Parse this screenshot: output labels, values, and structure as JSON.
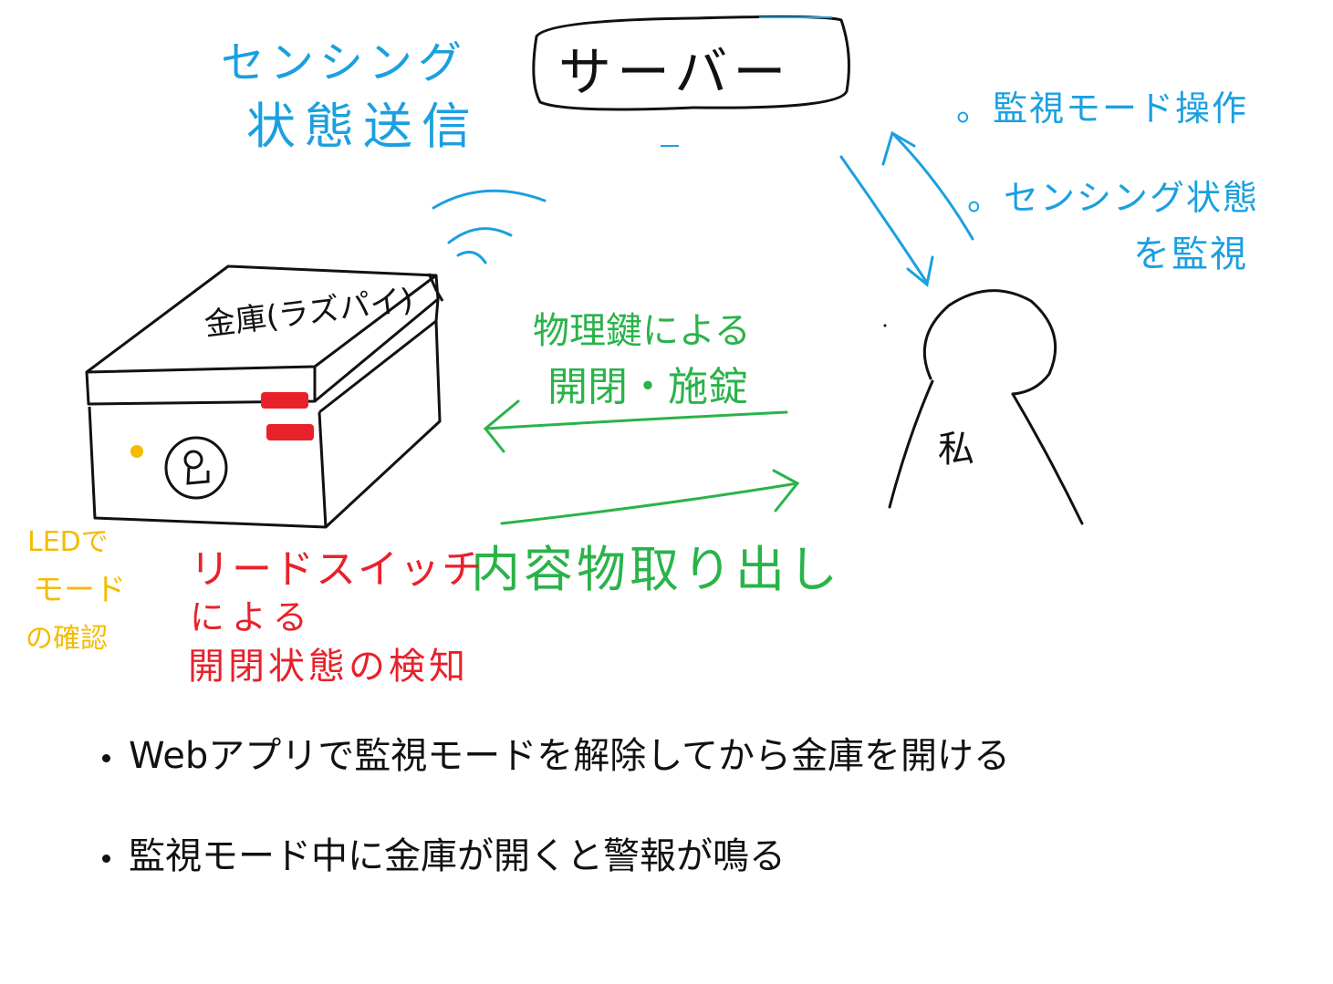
{
  "server": {
    "label": "サーバー"
  },
  "sensing_send": {
    "line1": "センシング",
    "line2": "状態送信"
  },
  "monitor_ops": {
    "item1": "。監視モード操作",
    "item2_line1": "。センシング状態",
    "item2_line2": "を監視"
  },
  "safe": {
    "label": "金庫(ラズパイ)"
  },
  "person": {
    "label": "私"
  },
  "physical_key": {
    "line1": "物理鍵による",
    "line2": "開閉・施錠"
  },
  "take_out": {
    "label": "内容物取り出し"
  },
  "reed_switch": {
    "line1": "リードスイッチ",
    "line2": "による",
    "line3": "開閉状態の検知"
  },
  "led": {
    "line1": "LEDで",
    "line2": "モード",
    "line3": "の確認"
  },
  "notes": [
    "Webアプリで監視モードを解除してから金庫を開ける",
    "監視モード中に金庫が開くと警報が鳴る"
  ],
  "colors": {
    "blue": "#1aa0e0",
    "green": "#2ab34a",
    "red": "#e8212a",
    "yellow": "#f5bb00",
    "ink": "#111111"
  }
}
